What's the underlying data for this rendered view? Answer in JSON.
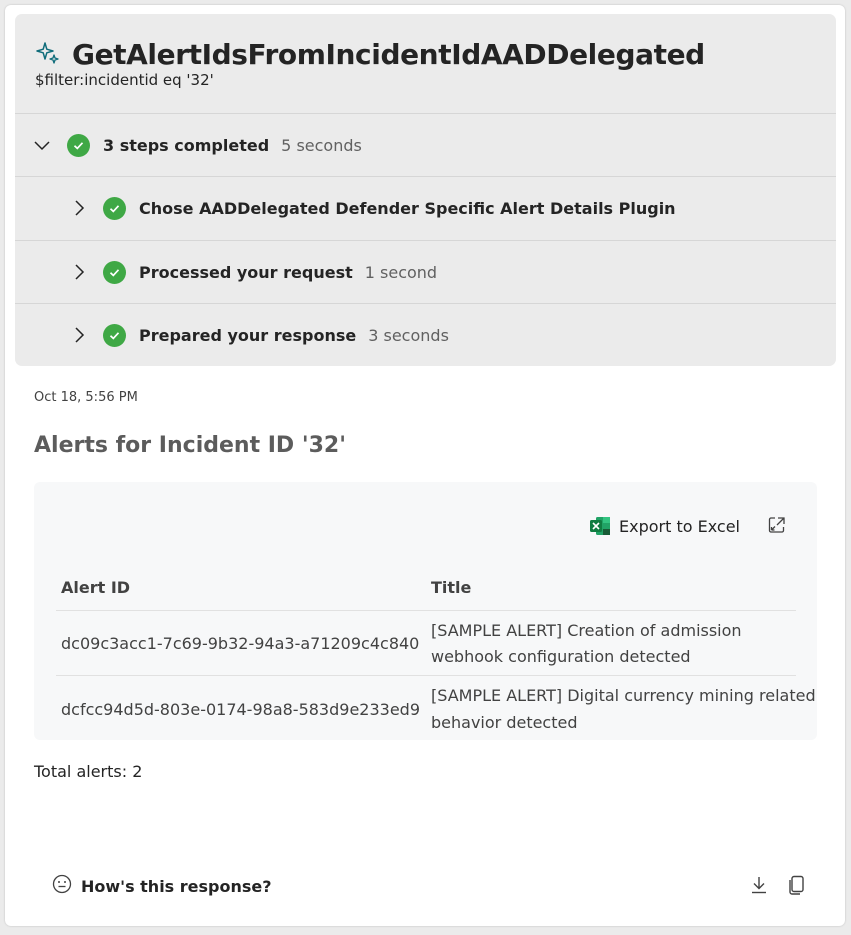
{
  "header": {
    "title": "GetAlertIdsFromIncidentIdAADDelegated",
    "subtitle": "$filter:incidentid eq '32'",
    "icon": "sparkle-icon"
  },
  "steps_summary": {
    "label": "3 steps completed",
    "duration": "5 seconds",
    "expanded": true
  },
  "steps": [
    {
      "label": "Chose AADDelegated Defender Specific Alert Details Plugin",
      "duration": ""
    },
    {
      "label": "Processed your request",
      "duration": "1 second"
    },
    {
      "label": "Prepared your response",
      "duration": "3 seconds"
    }
  ],
  "timestamp": "Oct 18, 5:56 PM",
  "section_title": "Alerts for Incident ID '32'",
  "toolbar": {
    "export_label": "Export to Excel"
  },
  "table": {
    "columns": [
      "Alert ID",
      "Title"
    ],
    "rows": [
      {
        "alert_id": "dc09c3acc1-7c69-9b32-94a3-a71209c4c840",
        "title_line1": "[SAMPLE ALERT] Creation of admission",
        "title_line2": "webhook configuration detected"
      },
      {
        "alert_id": "dcfcc94d5d-803e-0174-98a8-583d9e233ed9",
        "title_line1": "[SAMPLE ALERT] Digital currency mining related",
        "title_line2": "behavior detected"
      }
    ]
  },
  "total": "Total alerts: 2",
  "feedback": {
    "label": "How's this response?"
  },
  "colors": {
    "success": "#3fa845",
    "accent_teal": "#0f6c7a",
    "excel_green": "#107c41"
  }
}
